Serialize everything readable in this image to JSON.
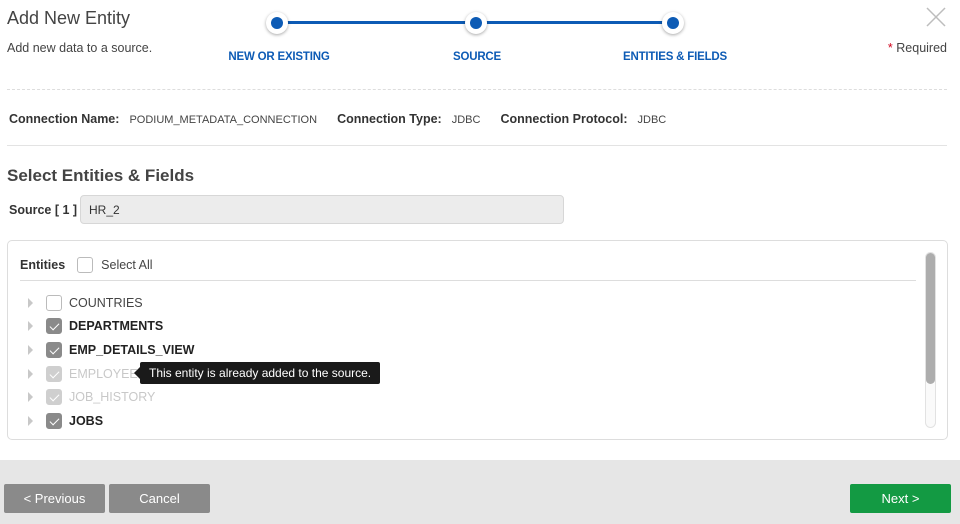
{
  "header": {
    "title": "Add New Entity",
    "subtitle": "Add new data to a source.",
    "required_star": "*",
    "required_label": "Required"
  },
  "stepper": {
    "color": "#0d5bb5",
    "steps": [
      {
        "label": "NEW OR EXISTING",
        "state": "complete"
      },
      {
        "label": "SOURCE",
        "state": "complete"
      },
      {
        "label": "ENTITIES & FIELDS",
        "state": "active"
      }
    ]
  },
  "connection": {
    "name_label": "Connection Name:",
    "name_value": "PODIUM_METADATA_CONNECTION",
    "type_label": "Connection Type:",
    "type_value": "JDBC",
    "protocol_label": "Connection Protocol:",
    "protocol_value": "JDBC"
  },
  "section": {
    "title": "Select Entities & Fields",
    "source_label": "Source [ 1 ]",
    "source_value": "HR_2"
  },
  "entities": {
    "header_label": "Entities",
    "select_all_label": "Select All",
    "select_all_checked": false,
    "items": [
      {
        "name": "COUNTRIES",
        "checked": false,
        "disabled": false
      },
      {
        "name": "DEPARTMENTS",
        "checked": true,
        "disabled": false
      },
      {
        "name": "EMP_DETAILS_VIEW",
        "checked": true,
        "disabled": false
      },
      {
        "name": "EMPLOYEES",
        "checked": true,
        "disabled": true
      },
      {
        "name": "JOB_HISTORY",
        "checked": true,
        "disabled": true
      },
      {
        "name": "JOBS",
        "checked": true,
        "disabled": false
      }
    ],
    "tooltip": "This entity is already added to the source."
  },
  "footer": {
    "previous_label": "< Previous",
    "cancel_label": "Cancel",
    "next_label": "Next >",
    "next_color": "#139a43"
  }
}
